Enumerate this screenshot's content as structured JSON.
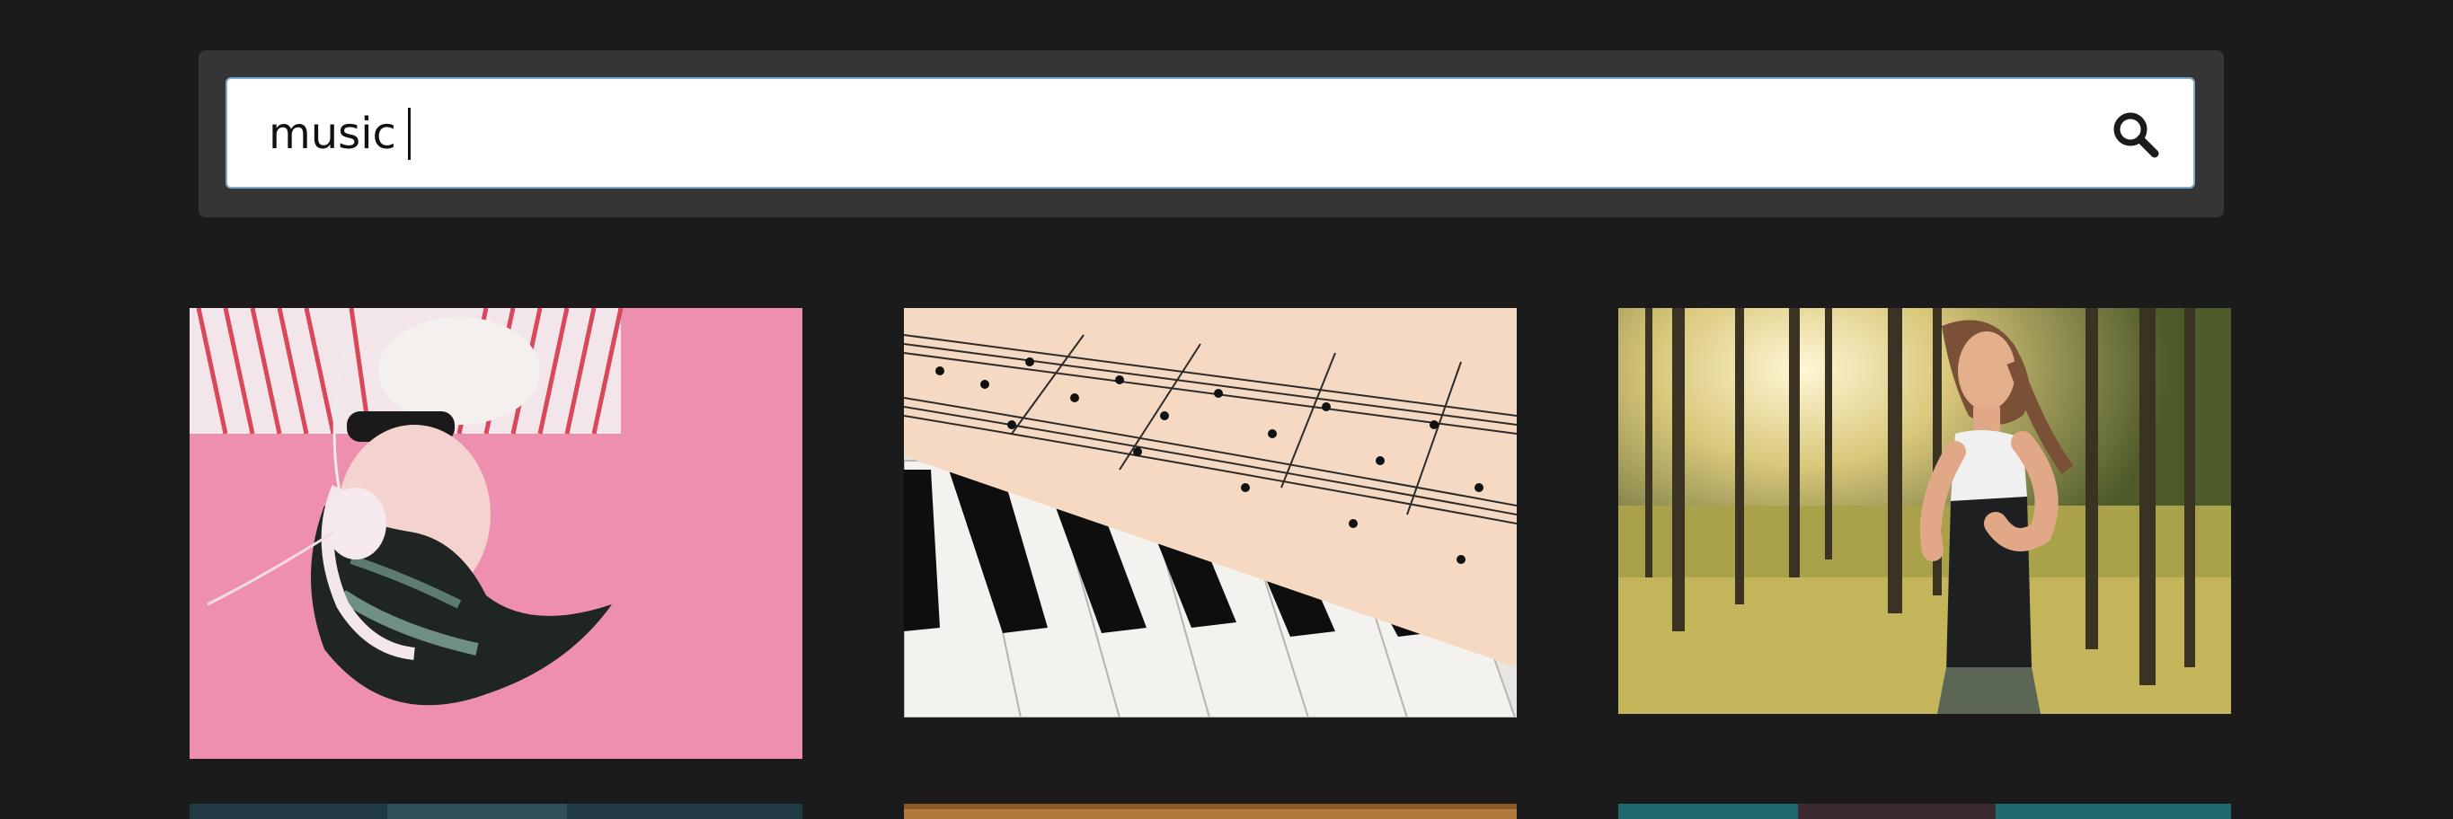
{
  "search": {
    "value": "music",
    "placeholder": ""
  },
  "results": [
    {
      "subject": "woman-with-headphones-on-pink-background"
    },
    {
      "subject": "sheet-music-on-piano-keys"
    },
    {
      "subject": "woman-jogging-in-forest"
    },
    {
      "subject": "partial-image-dark-teal"
    },
    {
      "subject": "partial-image-wood"
    },
    {
      "subject": "partial-image-teal"
    }
  ],
  "colors": {
    "background": "#1b1b1b",
    "panel": "#353535",
    "input_border": "#7fa9c9"
  },
  "icons": {
    "search_button": "search-icon"
  }
}
